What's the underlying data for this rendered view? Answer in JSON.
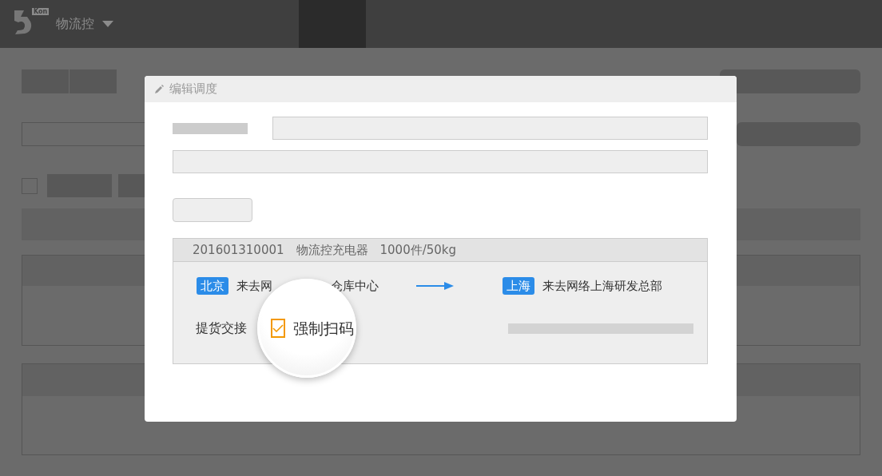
{
  "app": {
    "logo_tag": "Kon",
    "name": "物流控"
  },
  "list": {
    "select_all": {
      "checked": false
    }
  },
  "dialog": {
    "title": "编辑调度",
    "order": {
      "number": "201601310001",
      "product": "物流控充电器",
      "quantity": "1000件/50kg"
    },
    "origin": {
      "city": "北京",
      "address_start": "来去网",
      "address_end": "仓库中心"
    },
    "destination": {
      "city": "上海",
      "address": "来去网络上海研发总部"
    },
    "handover": {
      "label": "提货交接"
    },
    "magnifier": {
      "option": {
        "label": "强制扫码",
        "checked": true
      }
    }
  }
}
